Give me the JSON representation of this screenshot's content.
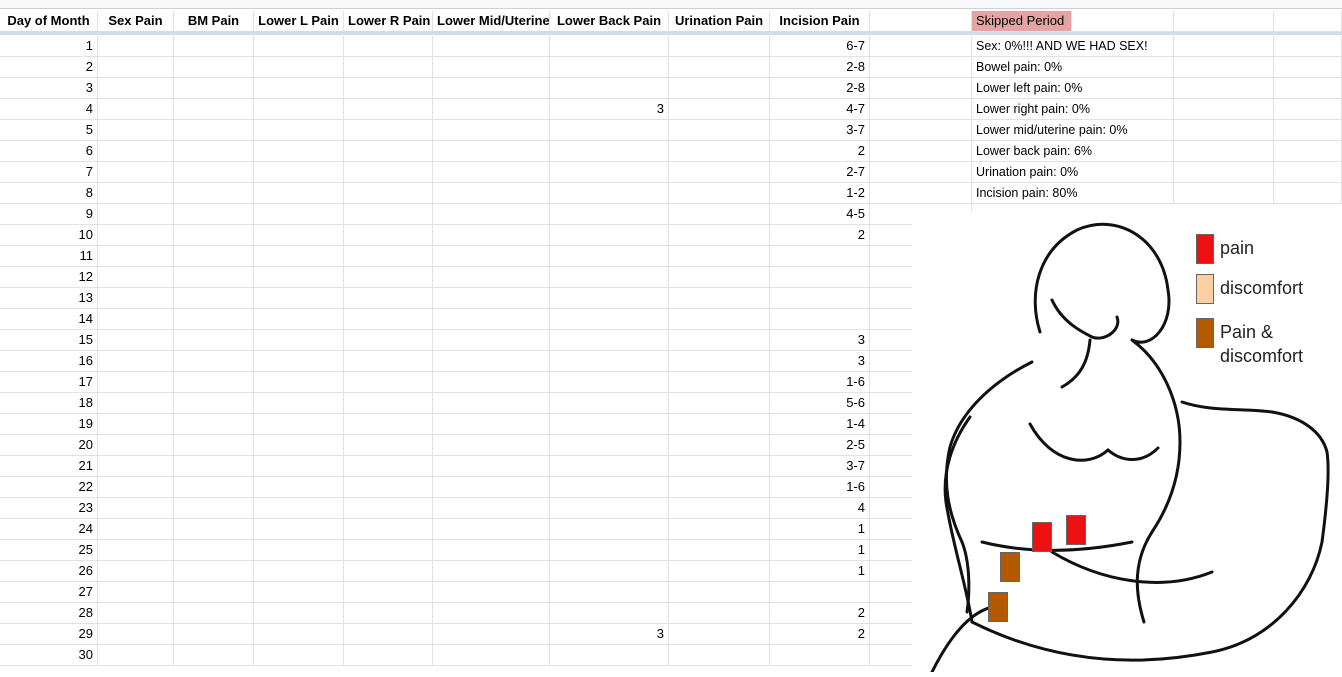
{
  "headers": [
    "Day of Month",
    "Sex Pain",
    "BM Pain",
    "Lower L Pain",
    "Lower R Pain",
    "Lower Mid/Uterine",
    "Lower Back Pain",
    "Urination Pain",
    "Incision Pain"
  ],
  "rows": [
    {
      "day": "1",
      "lower_back": "",
      "incision": "6-7"
    },
    {
      "day": "2",
      "lower_back": "",
      "incision": "2-8"
    },
    {
      "day": "3",
      "lower_back": "",
      "incision": "2-8"
    },
    {
      "day": "4",
      "lower_back": "3",
      "incision": "4-7"
    },
    {
      "day": "5",
      "lower_back": "",
      "incision": "3-7"
    },
    {
      "day": "6",
      "lower_back": "",
      "incision": "2"
    },
    {
      "day": "7",
      "lower_back": "",
      "incision": "2-7"
    },
    {
      "day": "8",
      "lower_back": "",
      "incision": "1-2"
    },
    {
      "day": "9",
      "lower_back": "",
      "incision": "4-5"
    },
    {
      "day": "10",
      "lower_back": "",
      "incision": "2"
    },
    {
      "day": "11",
      "lower_back": "",
      "incision": ""
    },
    {
      "day": "12",
      "lower_back": "",
      "incision": ""
    },
    {
      "day": "13",
      "lower_back": "",
      "incision": ""
    },
    {
      "day": "14",
      "lower_back": "",
      "incision": ""
    },
    {
      "day": "15",
      "lower_back": "",
      "incision": "3"
    },
    {
      "day": "16",
      "lower_back": "",
      "incision": "3"
    },
    {
      "day": "17",
      "lower_back": "",
      "incision": "1-6"
    },
    {
      "day": "18",
      "lower_back": "",
      "incision": "5-6"
    },
    {
      "day": "19",
      "lower_back": "",
      "incision": "1-4"
    },
    {
      "day": "20",
      "lower_back": "",
      "incision": "2-5"
    },
    {
      "day": "21",
      "lower_back": "",
      "incision": "3-7"
    },
    {
      "day": "22",
      "lower_back": "",
      "incision": "1-6"
    },
    {
      "day": "23",
      "lower_back": "",
      "incision": "4"
    },
    {
      "day": "24",
      "lower_back": "",
      "incision": "1"
    },
    {
      "day": "25",
      "lower_back": "",
      "incision": "1"
    },
    {
      "day": "26",
      "lower_back": "",
      "incision": "1"
    },
    {
      "day": "27",
      "lower_back": "",
      "incision": ""
    },
    {
      "day": "28",
      "lower_back": "",
      "incision": "2"
    },
    {
      "day": "29",
      "lower_back": "3",
      "incision": "2"
    },
    {
      "day": "30",
      "lower_back": "",
      "incision": ""
    }
  ],
  "skipped_period_label": "Skipped Period",
  "summary": [
    "Sex: 0%!!! AND WE HAD SEX!",
    "Bowel pain: 0%",
    "Lower left pain:  0%",
    "Lower right pain: 0%",
    "Lower mid/uterine pain: 0%",
    "Lower back pain: 6%",
    "Urination pain: 0%",
    "Incision pain: 80%"
  ],
  "legend": [
    {
      "label": "pain",
      "color": "#ee1111"
    },
    {
      "label": "discomfort",
      "color": "#fbcfa0"
    },
    {
      "label": "Pain & discomfort",
      "color": "#b35a00"
    }
  ],
  "colors": {
    "gridline": "#e2e2e2",
    "skipped_bg": "#e6a3a3",
    "freeze_bar": "#d3dbe6"
  }
}
